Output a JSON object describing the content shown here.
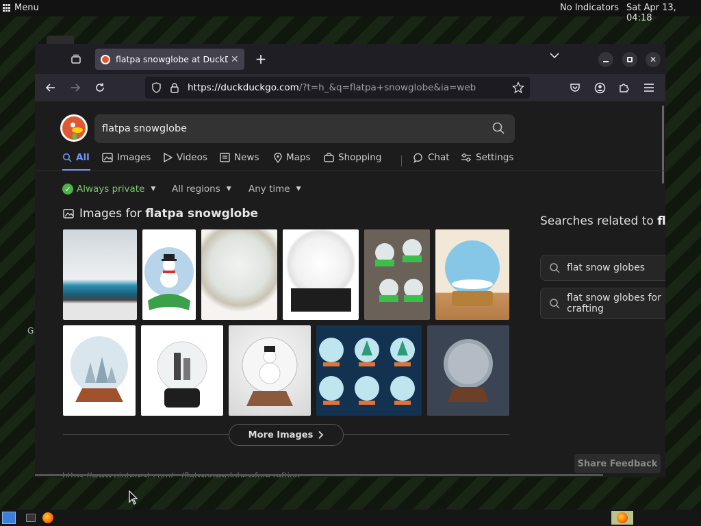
{
  "top_panel": {
    "menu_label": "Menu",
    "indicators": "No Indicators",
    "clock": "Sat Apr 13, 04:18"
  },
  "desktop": {
    "stray_text": "G"
  },
  "browser": {
    "tab": {
      "title": "flatpa snowglobe at DuckDuckGo",
      "close": "✕"
    },
    "new_tab": "+",
    "url": {
      "host": "https://duckduckgo.com",
      "path": "/?t=h_&q=flatpa+snowglobe&ia=web"
    }
  },
  "page": {
    "search": {
      "value": "flatpa snowglobe"
    },
    "nav_tabs": [
      {
        "label": "All",
        "icon": "search-icon"
      },
      {
        "label": "Images",
        "icon": "image-icon"
      },
      {
        "label": "Videos",
        "icon": "play-icon"
      },
      {
        "label": "News",
        "icon": "news-icon"
      },
      {
        "label": "Maps",
        "icon": "pin-icon"
      },
      {
        "label": "Shopping",
        "icon": "bag-icon"
      },
      {
        "label": "Chat",
        "icon": "chat-icon"
      },
      {
        "label": "Settings",
        "icon": "sliders-icon"
      }
    ],
    "filters": {
      "privacy": "Always private",
      "region": "All regions",
      "time": "Any time"
    },
    "images_heading": {
      "prefix": "Images for",
      "query": "flatpa snowglobe"
    },
    "more_images": "More Images",
    "related": {
      "title_prefix": "Searches related to",
      "title_query": "flatpa snowglobe",
      "items": [
        "flat snow globes",
        "flat snow globes for crafting"
      ]
    },
    "share_feedback": "Share Feedback",
    "bottom_hint": "https://www.pinterest.com/.../flat-snow-globes-for-crafting"
  },
  "colors": {
    "accent": "#7295f6",
    "ddg_orange": "#de5833",
    "private_green": "#7bc96f"
  }
}
